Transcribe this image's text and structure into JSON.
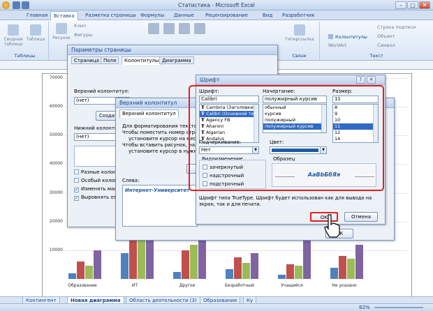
{
  "window": {
    "title": "Статистика - Microsoft Excel",
    "min": "–",
    "max": "□",
    "close": "✕"
  },
  "ribbon_tabs": [
    "Главная",
    "Вставка",
    "Разметка страницы",
    "Формулы",
    "Данные",
    "Рецензирование",
    "Вид",
    "Разработчик"
  ],
  "ribbon": {
    "groups": [
      "Таблицы",
      "Связи",
      "Текст"
    ],
    "items": {
      "pivot": "Сводная таблица",
      "table": "Таблица",
      "picture": "Рисунок",
      "clip": "Клип",
      "shapes": "Фигуры",
      "hyperlink": "Гиперссылка",
      "headers": "Колонтитулы",
      "wordart": "WordArt",
      "sig": "Строка подписи",
      "object": "Объект",
      "symbol": "Символ"
    }
  },
  "chart": {
    "y_ticks": [
      "70000",
      "60000",
      "50000",
      "40000",
      "30000",
      "20000",
      "10000"
    ],
    "categories": [
      "Образование",
      "ИТ",
      "Другое",
      "Безработный",
      "Учащийся",
      "Не указано"
    ]
  },
  "chart_data": {
    "type": "bar",
    "categories": [
      "Образование",
      "ИТ",
      "Другое",
      "Безработный",
      "Учащийся",
      "Не указано"
    ],
    "series": [
      {
        "color": "#4f81bd",
        "values": [
          2000,
          9000,
          2500,
          3500,
          1500,
          4000
        ]
      },
      {
        "color": "#c0504d",
        "values": [
          6000,
          24000,
          10000,
          7500,
          5000,
          8000
        ]
      },
      {
        "color": "#9bbb59",
        "values": [
          4500,
          21000,
          12000,
          5500,
          4500,
          7000
        ]
      },
      {
        "color": "#8064a2",
        "values": [
          10000,
          33000,
          19000,
          9000,
          17000,
          12000
        ]
      }
    ],
    "ylim": [
      0,
      70000
    ]
  },
  "sheet_tabs": [
    "Контингент",
    "Новая диаграмма",
    "Область деятельности (3)",
    "Образование",
    "Ку"
  ],
  "status": {
    "zoom": "82%"
  },
  "page_setup": {
    "title": "Параметры страницы",
    "tabs": [
      "Страница",
      "Поля",
      "Колонтитулы",
      "Диаграмма"
    ],
    "header_label": "Верхний колонтитул:",
    "header_value": "(нет)",
    "create_btn": "Создать",
    "footer_label": "Нижний колонтитул:",
    "footer_value": "(нет)",
    "checks": [
      "Разные колонтитулы",
      "Особый колонтитул",
      "Изменять масштаб",
      "Выровнять относительно"
    ]
  },
  "header_dlg": {
    "title": "Верхний колонтитул",
    "tab": "Верхний колонтитул",
    "instr": [
      "Для форматирования текста выд",
      "Чтобы поместить номер страниц",
      "установите курсор на место в",
      "Чтобы вставить рисунок, нажмит",
      "установите курсор в нужное п"
    ],
    "left_label": "Слева:",
    "left_text": "Интернет-Университет",
    "ok": "ОК"
  },
  "font_dlg": {
    "title": "Шрифт",
    "font_label": "Шрифт:",
    "font_value": "Calibri",
    "fonts": [
      "Cambria (Заголовки)",
      "Calibri (Основной текст)",
      "Agency FB",
      "Aharoni",
      "Algerian",
      "Andalus"
    ],
    "style_label": "Начертание:",
    "style_value": "полужирный курсив",
    "styles": [
      "обычный",
      "курсив",
      "полужирный",
      "полужирный курсив"
    ],
    "size_label": "Размер:",
    "size_value": "11",
    "sizes": [
      "8",
      "9",
      "10",
      "11",
      "12",
      "14"
    ],
    "underline_label": "Подчеркивание:",
    "underline_value": "Нет",
    "color_label": "Цвет:",
    "effects_label": "Видоизменение",
    "effects": [
      "зачеркнутый",
      "надстрочный",
      "подстрочный"
    ],
    "sample_label": "Образец",
    "sample_text": "АаВbБбЯя",
    "note": "Шрифт типа TrueType. Шрифт будет использован как для вывода на экран, так и для печати.",
    "ok": "ОК",
    "cancel": "Отмена",
    "help": "?",
    "close": "✕"
  }
}
